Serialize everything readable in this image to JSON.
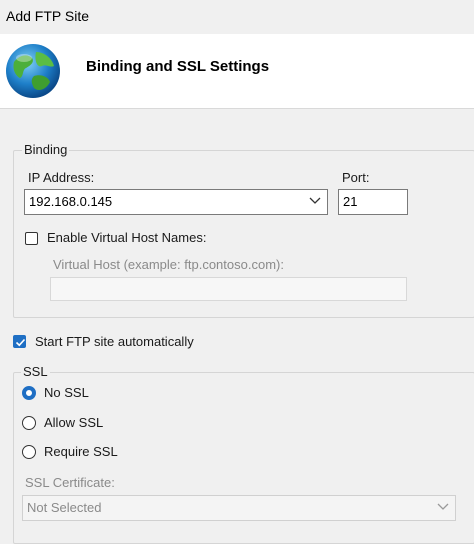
{
  "window": {
    "title": "Add FTP Site"
  },
  "header": {
    "heading": "Binding and SSL Settings",
    "icon": "globe-icon"
  },
  "binding": {
    "legend": "Binding",
    "ip_label": "IP Address:",
    "ip_value": "192.168.0.145",
    "port_label": "Port:",
    "port_value": "21",
    "virtual_host_checkbox_label": "Enable Virtual Host Names:",
    "virtual_host_checked": false,
    "virtual_host_label": "Virtual Host (example: ftp.contoso.com):",
    "virtual_host_value": ""
  },
  "start_automatically": {
    "label": "Start FTP site automatically",
    "checked": true
  },
  "ssl": {
    "legend": "SSL",
    "options": [
      "No SSL",
      "Allow SSL",
      "Require SSL"
    ],
    "selected": "No SSL",
    "certificate_label": "SSL Certificate:",
    "certificate_value": "Not Selected"
  },
  "colors": {
    "accent": "#1f6fc4",
    "header_bg": "#ffffff",
    "dialog_bg": "#f0f0f0"
  }
}
